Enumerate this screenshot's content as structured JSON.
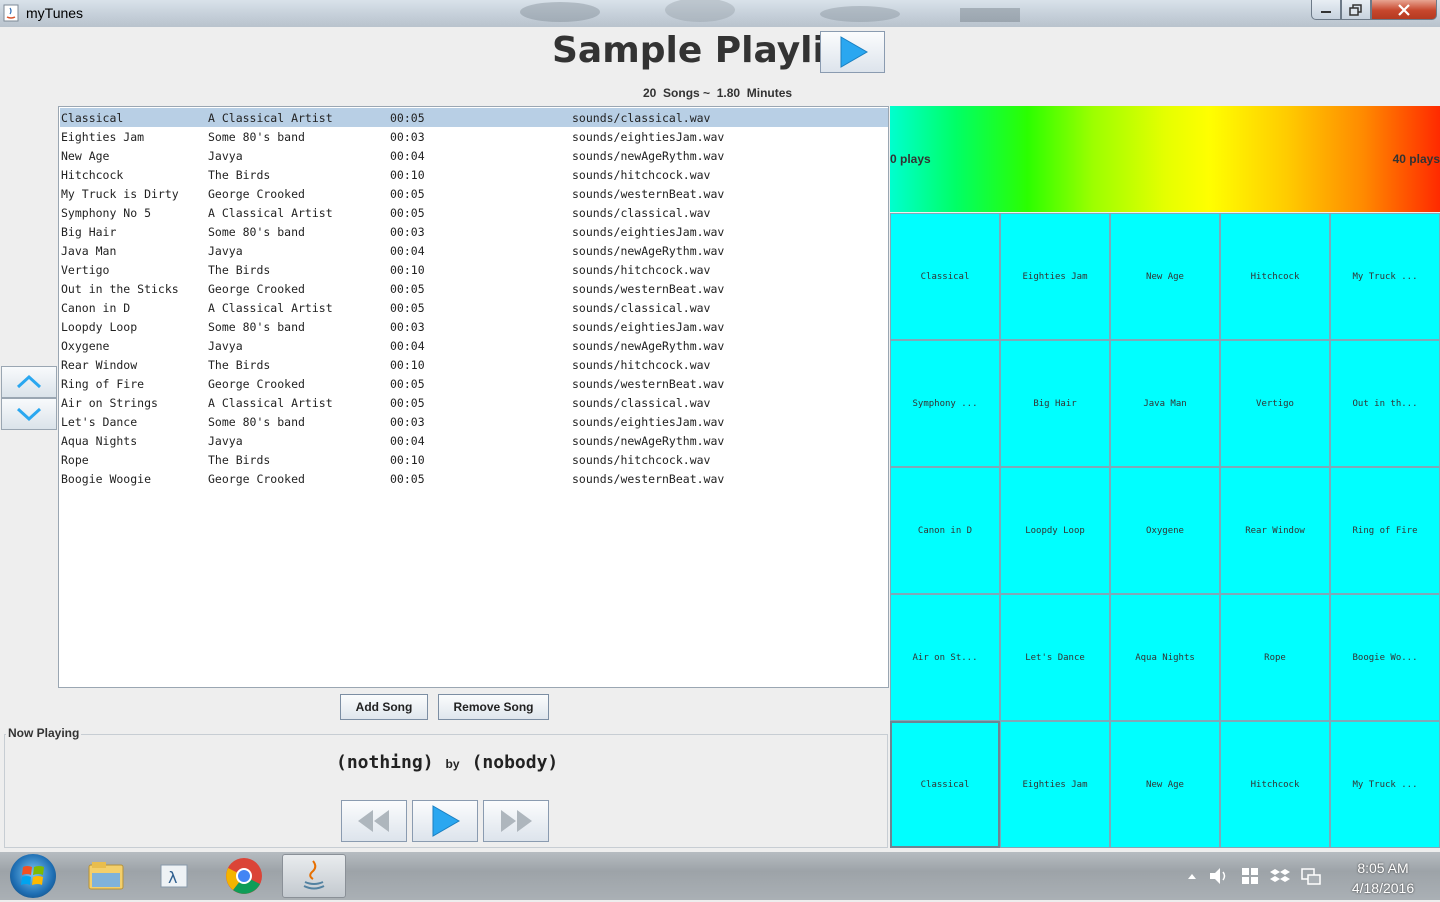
{
  "window": {
    "title": "myTunes"
  },
  "header": {
    "title": "Sample Playlist",
    "song_count": "20",
    "songs_label": "Songs ~",
    "minutes": "1.80",
    "minutes_label": "Minutes"
  },
  "songs": [
    {
      "title": "Classical",
      "artist": "A Classical Artist",
      "time": "00:05",
      "file": "sounds/classical.wav"
    },
    {
      "title": "Eighties Jam",
      "artist": "Some 80's band",
      "time": "00:03",
      "file": "sounds/eightiesJam.wav"
    },
    {
      "title": "New Age",
      "artist": "Javya",
      "time": "00:04",
      "file": "sounds/newAgeRythm.wav"
    },
    {
      "title": "Hitchcock",
      "artist": "The Birds",
      "time": "00:10",
      "file": "sounds/hitchcock.wav"
    },
    {
      "title": "My Truck is Dirty",
      "artist": "George Crooked",
      "time": "00:05",
      "file": "sounds/westernBeat.wav"
    },
    {
      "title": "Symphony No 5",
      "artist": "A Classical Artist",
      "time": "00:05",
      "file": "sounds/classical.wav"
    },
    {
      "title": "Big Hair",
      "artist": "Some 80's band",
      "time": "00:03",
      "file": "sounds/eightiesJam.wav"
    },
    {
      "title": "Java Man",
      "artist": "Javya",
      "time": "00:04",
      "file": "sounds/newAgeRythm.wav"
    },
    {
      "title": "Vertigo",
      "artist": "The Birds",
      "time": "00:10",
      "file": "sounds/hitchcock.wav"
    },
    {
      "title": "Out in the Sticks",
      "artist": "George Crooked",
      "time": "00:05",
      "file": "sounds/westernBeat.wav"
    },
    {
      "title": "Canon in D",
      "artist": "A Classical Artist",
      "time": "00:05",
      "file": "sounds/classical.wav"
    },
    {
      "title": "Loopdy Loop",
      "artist": "Some 80's band",
      "time": "00:03",
      "file": "sounds/eightiesJam.wav"
    },
    {
      "title": "Oxygene",
      "artist": "Javya",
      "time": "00:04",
      "file": "sounds/newAgeRythm.wav"
    },
    {
      "title": "Rear Window",
      "artist": "The Birds",
      "time": "00:10",
      "file": "sounds/hitchcock.wav"
    },
    {
      "title": "Ring of Fire",
      "artist": "George Crooked",
      "time": "00:05",
      "file": "sounds/westernBeat.wav"
    },
    {
      "title": "Air on Strings",
      "artist": "A Classical Artist",
      "time": "00:05",
      "file": "sounds/classical.wav"
    },
    {
      "title": "Let's Dance",
      "artist": "Some 80's band",
      "time": "00:03",
      "file": "sounds/eightiesJam.wav"
    },
    {
      "title": "Aqua Nights",
      "artist": "Javya",
      "time": "00:04",
      "file": "sounds/newAgeRythm.wav"
    },
    {
      "title": "Rope",
      "artist": "The Birds",
      "time": "00:10",
      "file": "sounds/hitchcock.wav"
    },
    {
      "title": "Boogie Woogie",
      "artist": "George Crooked",
      "time": "00:05",
      "file": "sounds/westernBeat.wav"
    }
  ],
  "selected_row": 0,
  "buttons": {
    "add_song": "Add Song",
    "remove_song": "Remove Song"
  },
  "now_playing": {
    "label": "Now Playing",
    "song": "(nothing)",
    "by": "by",
    "artist": "(nobody)"
  },
  "legend": {
    "min_label": "0 plays",
    "max_label": "40 plays"
  },
  "tiles": [
    "Classical",
    "Eighties Jam",
    "New Age",
    "Hitchcock",
    "My Truck ...",
    "Symphony ...",
    "Big Hair",
    "Java Man",
    "Vertigo",
    "Out in th...",
    "Canon in D",
    "Loopdy Loop",
    "Oxygene",
    "Rear Window",
    "Ring of Fire",
    "Air on St...",
    "Let's Dance",
    "Aqua Nights",
    "Rope",
    "Boogie Wo...",
    "Classical",
    "Eighties Jam",
    "New Age",
    "Hitchcock",
    "My Truck ..."
  ],
  "selected_tile": 20,
  "colors": {
    "tile": "#00ffff",
    "selected_row": "#b8cfe5",
    "accent_play": "#2aa7f0"
  },
  "taskbar": {
    "time": "8:05 AM",
    "date": "4/18/2016"
  },
  "icons": {
    "up": "chevron-up-icon",
    "down": "chevron-down-icon",
    "play": "play-icon",
    "rewind": "rewind-icon",
    "forward": "fast-forward-icon"
  }
}
